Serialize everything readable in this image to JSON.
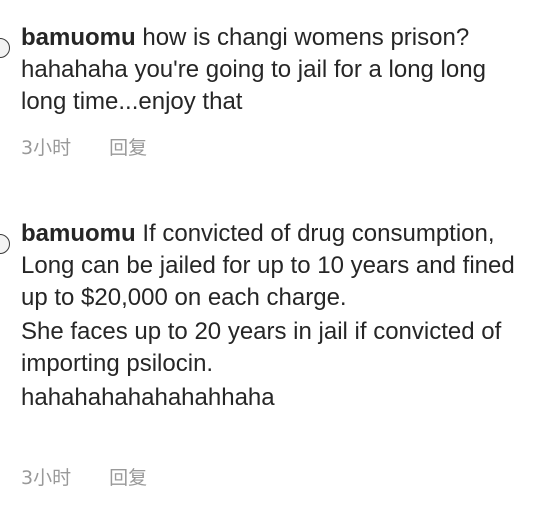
{
  "comments": [
    {
      "username": "bamuomu",
      "paragraphs": [
        " how is changi womens prison? hahahaha you're going to jail for a long long long time...enjoy that"
      ],
      "time": "3小时",
      "reply_label": "回复"
    },
    {
      "username": "bamuomu",
      "paragraphs": [
        " If convicted of drug consumption, Long can be jailed for up to 10 years and fined up to $20,000 on each charge.",
        "She faces up to 20 years in jail if convicted of importing psilocin.",
        "hahahahahahahahhaha"
      ],
      "time": "3小时",
      "reply_label": "回复"
    }
  ]
}
